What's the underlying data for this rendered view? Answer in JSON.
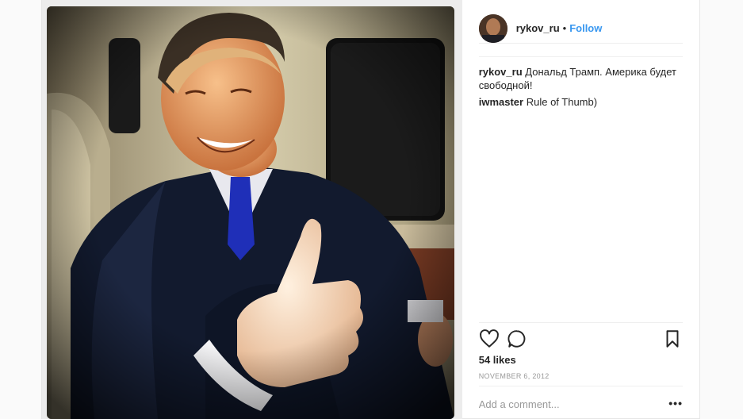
{
  "post": {
    "header": {
      "username": "rykov_ru",
      "separator": "•",
      "follow_label": "Follow"
    },
    "comments": [
      {
        "username": "rykov_ru",
        "text": "Дональд Трамп. Америка будет свободной!"
      },
      {
        "username": "iwmaster",
        "text": "Rule of Thumb)"
      }
    ],
    "actions": {
      "like_icon": "heart-icon",
      "comment_icon": "comment-icon",
      "save_icon": "bookmark-icon"
    },
    "likes": "54 likes",
    "date": "NOVEMBER 6, 2012",
    "add_comment_placeholder": "Add a comment...",
    "more_label": "•••"
  },
  "colors": {
    "accent": "#3897f0",
    "text": "#262626",
    "muted": "#999999",
    "border": "#efefef"
  }
}
